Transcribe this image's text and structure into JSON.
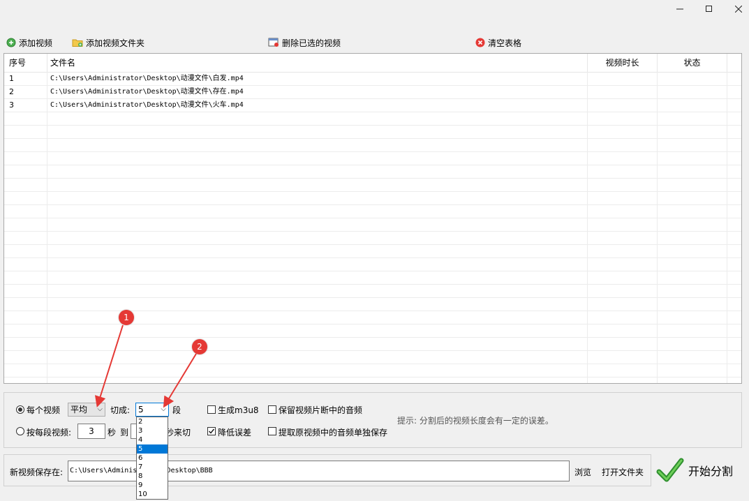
{
  "window": {
    "minimize_icon": "minimize-icon",
    "maximize_icon": "maximize-icon",
    "close_icon": "close-icon"
  },
  "toolbar": {
    "add_video": "添加视频",
    "add_folder": "添加视频文件夹",
    "delete_selected": "删除已选的视频",
    "clear_table": "清空表格"
  },
  "table": {
    "headers": [
      "序号",
      "文件名",
      "视频时长",
      "状态"
    ],
    "rows": [
      {
        "index": "1",
        "file": "C:\\Users\\Administrator\\Desktop\\动漫文件\\白发.mp4",
        "duration": "",
        "status": ""
      },
      {
        "index": "2",
        "file": "C:\\Users\\Administrator\\Desktop\\动漫文件\\存在.mp4",
        "duration": "",
        "status": ""
      },
      {
        "index": "3",
        "file": "C:\\Users\\Administrator\\Desktop\\动漫文件\\火车.mp4",
        "duration": "",
        "status": ""
      }
    ]
  },
  "options": {
    "mode_each": "每个视频",
    "mode_select_value": "平均",
    "cut_into_label": "切成:",
    "segments_value": "5",
    "segments_unit": "段",
    "mode_per_segment": "按每段视频:",
    "seconds_value": "3",
    "seconds_unit": "秒",
    "to_label": "到",
    "cut_suffix": "秒来切",
    "gen_m3u8": "生成m3u8",
    "reduce_error": "降低误差",
    "keep_audio": "保留视频片断中的音频",
    "extract_audio": "提取原视频中的音频单独保存",
    "tip": "提示: 分割后的视频长度会有一定的误差。",
    "dropdown_options": [
      "2",
      "3",
      "4",
      "5",
      "6",
      "7",
      "8",
      "9",
      "10"
    ],
    "dropdown_selected": "5"
  },
  "save": {
    "label": "新视频保存在:",
    "path": "C:\\Users\\Administrator\\Desktop\\BBB",
    "browse": "浏览",
    "open_folder": "打开文件夹",
    "start": "开始分割"
  },
  "annotations": [
    "1",
    "2"
  ],
  "colors": {
    "accent_selection": "#0078d7",
    "marker_red": "#e53935",
    "start_check_green": "#3aa53a"
  }
}
